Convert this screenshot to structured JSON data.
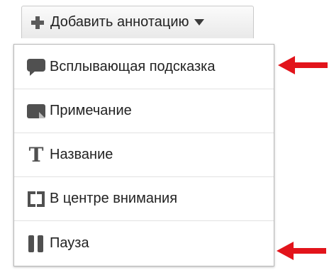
{
  "add_button": {
    "label": "Добавить аннотацию",
    "icon": "plus-icon",
    "caret_icon": "caret-down-icon"
  },
  "menu": {
    "items": [
      {
        "label": "Всплывающая подсказка",
        "icon": "speech-bubble-icon"
      },
      {
        "label": "Примечание",
        "icon": "note-icon"
      },
      {
        "label": "Название",
        "icon": "title-text-icon"
      },
      {
        "label": "В центре внимания",
        "icon": "spotlight-icon"
      },
      {
        "label": "Пауза",
        "icon": "pause-icon"
      }
    ]
  },
  "glyphs": {
    "title_icon": "T"
  },
  "colors": {
    "arrow": "#e2141b",
    "icon": "#505050",
    "button_border": "#c9c9c9",
    "menu_border": "#b9b9b9"
  }
}
